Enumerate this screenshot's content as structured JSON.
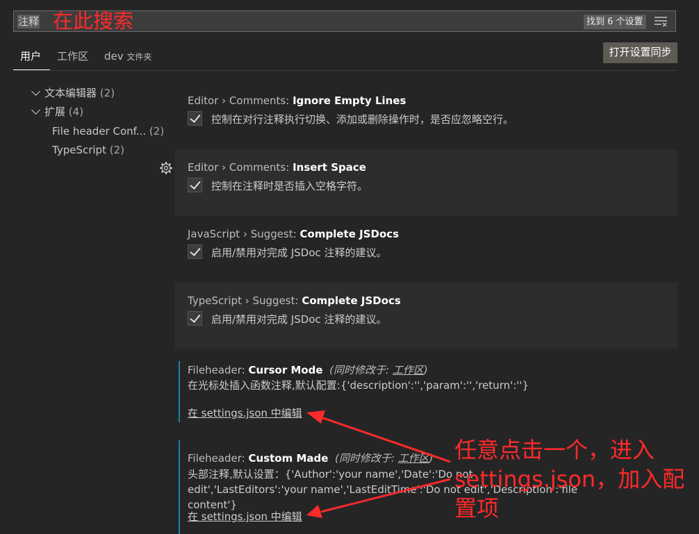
{
  "search": {
    "query": "注释",
    "annotation": "在此搜索",
    "found": "找到 6 个设置",
    "filter_icon": "filter-icon"
  },
  "tabs": [
    {
      "label": "用户"
    },
    {
      "label": "工作区"
    },
    {
      "label": "dev",
      "sub": "文件夹"
    }
  ],
  "sync_button": "打开设置同步",
  "tree": [
    {
      "label": "文本编辑器",
      "count": "(2)"
    },
    {
      "label": "扩展",
      "count": "(4)"
    },
    {
      "label": "File header Conf...",
      "count": "(2)"
    },
    {
      "label": "TypeScript",
      "count": "(2)"
    }
  ],
  "settings": [
    {
      "category": "Editor › Comments: ",
      "name": "Ignore Empty Lines",
      "desc": "控制在对行注释执行切换、添加或删除操作时，是否应忽略空行。",
      "checked": true
    },
    {
      "category": "Editor › Comments: ",
      "name": "Insert Space",
      "desc": "控制在注释时是否插入空格字符。",
      "checked": true
    },
    {
      "category": "JavaScript › Suggest: ",
      "name": "Complete JSDocs",
      "desc": "启用/禁用对完成 JSDoc 注释的建议。",
      "checked": true
    },
    {
      "category": "TypeScript › Suggest: ",
      "name": "Complete JSDocs",
      "desc": "启用/禁用对完成 JSDoc 注释的建议。",
      "checked": true
    },
    {
      "category": "Fileheader: ",
      "name": "Cursor Mode",
      "modified": "(同时修改于: ",
      "modified_link": "工作区",
      "modified_end": ")",
      "desc": "在光标处插入函数注释,默认配置:{'description':'','param':'','return':''}",
      "link": "在 settings.json 中编辑"
    },
    {
      "category": "Fileheader: ",
      "name": "Custom Made",
      "modified": "(同时修改于: ",
      "modified_link": "工作区",
      "modified_end": ")",
      "desc": "头部注释,默认设置：{'Author':'your name','Date':'Do not edit','LastEditors':'your name','LastEditTime':'Do not edit','Description':'file content'}",
      "link": "在 settings.json 中编辑"
    }
  ],
  "annotation": "任意点击一个，进入settings.json，加入配置项",
  "colors": {
    "annotation": "#ff2a2a",
    "modified_bar": "#1b80b2",
    "background": "#252526"
  }
}
